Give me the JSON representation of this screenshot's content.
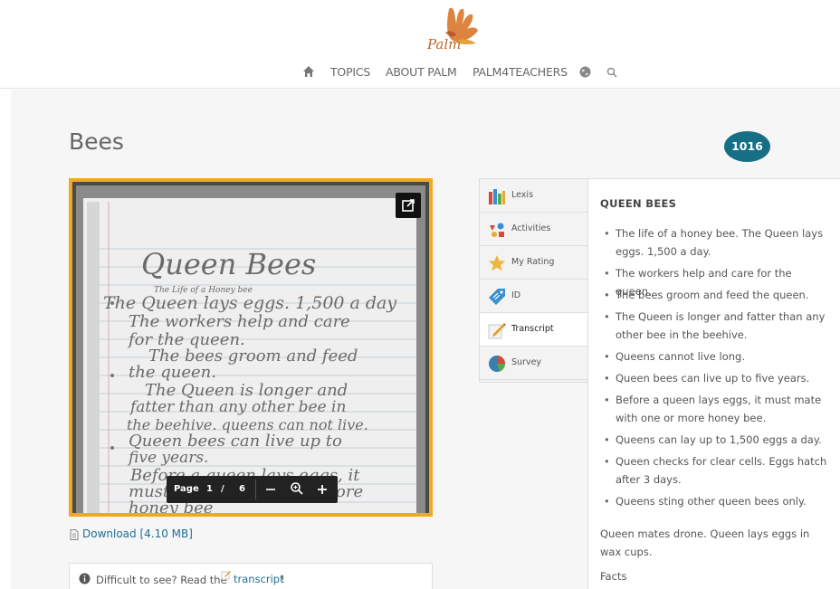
{
  "header": {
    "logo_text": "Palm",
    "nav": {
      "topics": "TOPICS",
      "about": "ABOUT PALM",
      "palm4teachers": "PALM4TEACHERS"
    },
    "icons": [
      "home-icon",
      "globe-icon",
      "search-icon"
    ]
  },
  "page": {
    "title": "Bees",
    "badge": "1016"
  },
  "viewer": {
    "page_label": "Page",
    "page_current": "1",
    "page_separator": "/",
    "page_total": "6",
    "handwriting_lines": [
      "Queen Bees",
      "The Life of a Honey bee",
      "The Queen lays eggs. 1,500 a day",
      "The workers help and care",
      "for the queen.",
      "The bees groom and feed",
      "the queen.",
      "The Queen is longer and",
      "fatter than any other bee in",
      "the beehive. queens can not live.",
      "Queen bees can live up to",
      "five years.",
      "Before a queen lays eggs, it",
      "must mate with one or more",
      "honey bee"
    ]
  },
  "download": {
    "label": "Download [4.10 MB]"
  },
  "hint": {
    "text": "Difficult to see? Read the",
    "link": "transcript",
    "end": "!"
  },
  "tabs": [
    {
      "label": "Lexis",
      "icon": "books-icon",
      "active": false
    },
    {
      "label": "Activities",
      "icon": "activities-icon",
      "active": false
    },
    {
      "label": "My Rating",
      "icon": "star-icon",
      "active": false
    },
    {
      "label": "ID",
      "icon": "tag-icon",
      "active": false
    },
    {
      "label": "Transcript",
      "icon": "pencil-paper-icon",
      "active": true
    },
    {
      "label": "Survey",
      "icon": "pie-chart-icon",
      "active": false
    }
  ],
  "transcript": {
    "heading": "QUEEN BEES",
    "bullets": [
      "The life of a honey bee. The Queen lays eggs. 1,500 a day.",
      "The workers help and care for the queen.",
      "The bees groom and feed the queen.",
      "The Queen is longer and fatter than any other bee in the beehive.",
      "Queens cannot live long.",
      "Queen bees can live up to five years.",
      "Before a queen lays eggs, it must mate with one or more honey bee.",
      "Queens can lay up to 1,500 eggs a day.",
      "Queen checks for clear cells. Eggs hatch after 3 days.",
      "Queens sting other queen bees only."
    ],
    "paragraph": "Queen mates drone. Queen lays eggs in wax cups.",
    "facts": "Facts"
  },
  "colors": {
    "accent_border": "#f0a81c",
    "badge": "#166f85",
    "link": "#1f6f94"
  }
}
